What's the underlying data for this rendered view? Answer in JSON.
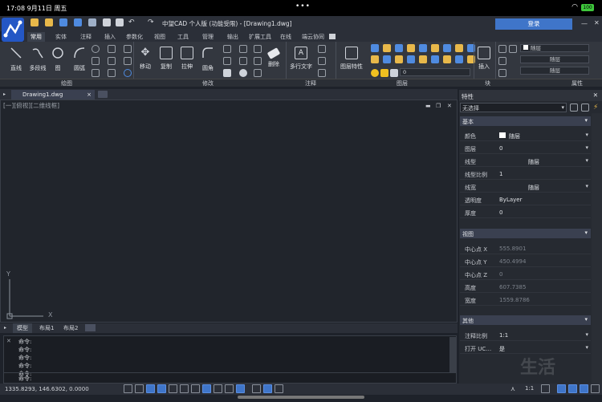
{
  "os": {
    "time": "17:08",
    "date": "9月11日 周五",
    "battery": "100",
    "dots": "•••"
  },
  "app": {
    "title": "中望CAD 个人版 (功能受限) - [Drawing1.dwg]",
    "login": "登录"
  },
  "ribbon_tabs": [
    "常用",
    "实体",
    "注释",
    "插入",
    "参数化",
    "视图",
    "工具",
    "管理",
    "输出",
    "扩展工具",
    "在线",
    "端云协同"
  ],
  "ribbon": {
    "draw": {
      "line": "直线",
      "polyline": "多段线",
      "hatch": "图",
      "arc": "圆弧"
    },
    "modify": {
      "move": "移动",
      "copy": "复制",
      "stretch": "拉伸",
      "fillet": "圆角",
      "erase": "删除"
    },
    "annotate": {
      "mtext": "多行文字"
    },
    "layers": {
      "props": "图层特性",
      "current": "0"
    },
    "block": {
      "insert": "插入"
    },
    "properties": {
      "color": "随层",
      "linetype": "随层",
      "lineweight": "随层"
    }
  },
  "panel_labels": [
    "绘图",
    "修改",
    "注释",
    "图层",
    "块",
    "属性"
  ],
  "doc_tab": "Drawing1.dwg",
  "canvas": {
    "view_label": "[一][俯视][二维线框]",
    "ucs_y": "Y",
    "ucs_x": "X"
  },
  "layout_tabs": [
    "模型",
    "布局1",
    "布局2"
  ],
  "command_lines": [
    "命令:",
    "命令:",
    "命令:",
    "命令:",
    "命令:"
  ],
  "command_prompt": "命令:",
  "status": {
    "coords": "1335.8293, 146.6302, 0.0000",
    "scale": "1:1"
  },
  "properties": {
    "title": "特性",
    "selection": "无选择",
    "basic": {
      "header": "基本",
      "rows": [
        {
          "k": "颜色",
          "v": "随层"
        },
        {
          "k": "图层",
          "v": "0"
        },
        {
          "k": "线型",
          "v": "随层"
        },
        {
          "k": "线型比例",
          "v": "1"
        },
        {
          "k": "线宽",
          "v": "随层"
        },
        {
          "k": "透明度",
          "v": "ByLayer"
        },
        {
          "k": "厚度",
          "v": "0"
        }
      ]
    },
    "view": {
      "header": "视图",
      "rows": [
        {
          "k": "中心点 X",
          "v": "555.8901"
        },
        {
          "k": "中心点 Y",
          "v": "450.4994"
        },
        {
          "k": "中心点 Z",
          "v": "0"
        },
        {
          "k": "高度",
          "v": "607.7385"
        },
        {
          "k": "宽度",
          "v": "1559.8786"
        }
      ]
    },
    "other": {
      "header": "其他",
      "rows": [
        {
          "k": "注释比例",
          "v": "1:1"
        },
        {
          "k": "打开 UC…",
          "v": "是"
        }
      ]
    }
  },
  "watermark": "生活"
}
